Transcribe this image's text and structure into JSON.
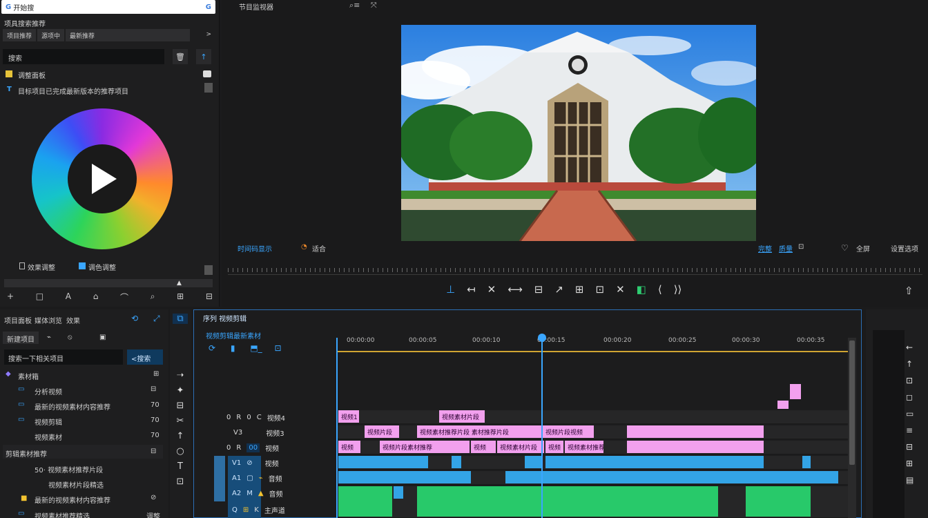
{
  "search": {
    "logo": "G",
    "text": "开始搜",
    "icon": "G"
  },
  "left_top": {
    "header": "项具搜索推荐",
    "tabs": [
      "项目推荐",
      "源项中",
      "最新推荐"
    ],
    "chevron": ">",
    "search_label": "搜索",
    "trash": "🗑",
    "up": "↑",
    "group_label": "调整面板",
    "sub_label": "目标项目已完成最新版本的推荐项目",
    "footer_left": "效果调整",
    "footer_right": "调色调整",
    "tools": [
      "+",
      "□",
      "A",
      "⌂",
      "⌒",
      "⌕",
      "⊞",
      "⊟"
    ]
  },
  "preview": {
    "title": "节目监视器",
    "header_icons": [
      "⌕≡",
      "⤧"
    ],
    "bottom_left": "时间码显示",
    "bottom_left2": "适合",
    "bottom_right": [
      "完整",
      "质量",
      "⊡"
    ],
    "bottom_right2": [
      "♡",
      "全屏",
      "设置选项"
    ],
    "transport": [
      "⊥",
      "↤",
      "✕",
      "⟷",
      "⊟",
      "↗",
      "⊞",
      "⊡",
      "✕",
      "◧",
      "⟨",
      "⟩⟩"
    ],
    "export": "⇧"
  },
  "project": {
    "tabs": [
      "项目面板",
      "媒体浏览",
      "效果"
    ],
    "tab_icons": [
      "⟲",
      "⤢"
    ],
    "row2": [
      "新建项目",
      "⌁",
      "⦸",
      "▣"
    ],
    "search_placeholder": "搜索一下相关项目",
    "search_btn": "<搜索",
    "items": [
      {
        "icon": "◆",
        "label": "素材箱",
        "right": "⊞"
      },
      {
        "icon": "▭",
        "label": "分析视频",
        "right": "⊟"
      },
      {
        "icon": "▭",
        "label": "最新的视频素材内容推荐",
        "right": "70"
      },
      {
        "icon": "▭",
        "label": "视频剪辑",
        "right": "70"
      },
      {
        "icon": "",
        "label": "视频素材",
        "right": "70"
      },
      {
        "icon": "",
        "label": "剪辑素材推荐",
        "right": "⊟"
      },
      {
        "icon": "",
        "label": "50·  视频素材推荐片段",
        "right": ""
      },
      {
        "icon": "",
        "label": "视频素材片段精选",
        "right": ""
      },
      {
        "icon": "■",
        "label": "最新的视频素材内容推荐",
        "right": "⊘"
      },
      {
        "icon": "▭",
        "label": "视频素材推荐精选",
        "right": "调整"
      }
    ]
  },
  "tools": [
    "⧉",
    "➝",
    "✦",
    "⊟",
    "✂",
    "↑",
    "○",
    "T",
    "⊡"
  ],
  "timeline": {
    "title": "序列 视频剪辑",
    "subtitle": "视频剪辑最新素材",
    "sub_icons": [
      "⟳",
      "▮",
      "⬒_",
      "⊡"
    ],
    "ticks": [
      "00:00:00",
      "00:00:05",
      "00:00:10",
      "00:00:15",
      "00:00:20",
      "00:00:25",
      "00:00:30",
      "00:00:35"
    ],
    "tracks": [
      {
        "a": "0",
        "b": "R",
        "c": "0",
        "d": "C",
        "name": "视频4"
      },
      {
        "a": "",
        "b": "",
        "c": "V3",
        "d": "",
        "name": "视频3"
      },
      {
        "a": "0",
        "b": "R",
        "c": "00",
        "d": "",
        "name": "视频"
      },
      {
        "a": "",
        "b": "V1",
        "c": "⊘",
        "d": "",
        "name": "视频"
      },
      {
        "a": "",
        "b": "A1",
        "c": "▢",
        "d": "⌁",
        "name": "音频"
      },
      {
        "a": "",
        "b": "A2",
        "c": "M",
        "d": "▲",
        "name": "音频"
      },
      {
        "a": "",
        "b": "Q",
        "c": "⊞",
        "d": "K",
        "name": "主声道"
      }
    ],
    "clip_labels": {
      "v4": [
        "视频1",
        "视频素材片段"
      ],
      "v3": [
        "视频片段",
        "视频素材推荐片段 素材推荐片段",
        "视频片段视频"
      ],
      "v2": [
        "视频",
        "视频片段素材推荐",
        "视频",
        "视频素材片段",
        "视频",
        "视频素材推荐片段"
      ]
    }
  },
  "right_icons": [
    "←",
    "↑",
    "⊡",
    "◻",
    "▭",
    "≡",
    "⊟",
    "⊞",
    "▤"
  ],
  "colors": {
    "accent": "#3aa6ff",
    "clip_pink": "#f2a0ee",
    "clip_blue": "#33a4e6",
    "clip_green": "#28c96a",
    "ruler_line": "#d1a532"
  }
}
